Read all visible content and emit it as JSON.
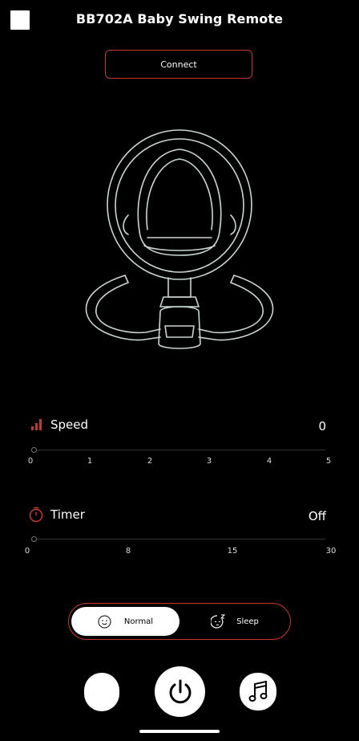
{
  "header": {
    "title": "BB702A Baby Swing Remote",
    "menu_icon": "square-icon"
  },
  "connect": {
    "label": "Connect"
  },
  "speed": {
    "label": "Speed",
    "value": "0",
    "ticks": [
      "0",
      "1",
      "2",
      "3",
      "4",
      "5"
    ],
    "level": 0,
    "icon": "signal-bars-icon"
  },
  "timer": {
    "label": "Timer",
    "value": "Off",
    "ticks": [
      "0",
      "8",
      "15",
      "30"
    ],
    "level": 0,
    "icon": "stopwatch-icon"
  },
  "mode": {
    "normal_label": "Normal",
    "sleep_label": "Sleep",
    "selected": "Normal"
  },
  "colors": {
    "accent": "#c0392b",
    "background": "#000000",
    "foreground": "#ffffff",
    "illustration": "#c9d6d3"
  }
}
